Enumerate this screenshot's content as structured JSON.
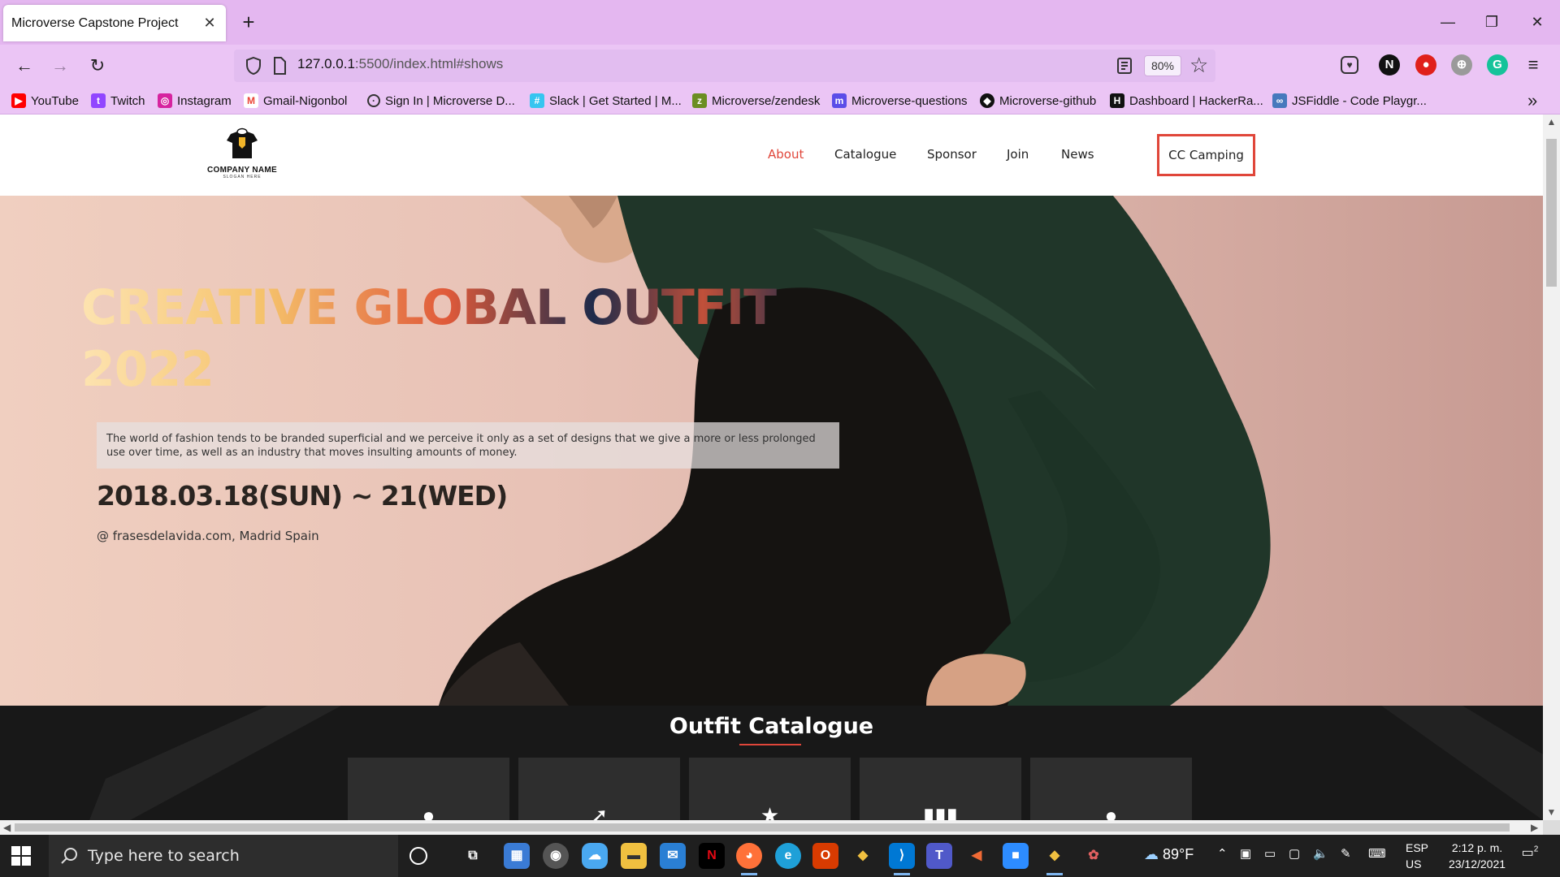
{
  "browser": {
    "tab_title": "Microverse Capstone Project",
    "url_host": "127.0.0.1",
    "url_rest": ":5500/index.html#shows",
    "zoom": "80%",
    "bookmarks": [
      {
        "label": "YouTube",
        "icon": "youtube-icon",
        "color": "#ff0000"
      },
      {
        "label": "Twitch",
        "icon": "twitch-icon",
        "color": "#9146ff"
      },
      {
        "label": "Instagram",
        "icon": "instagram-icon",
        "color": "#d6249f"
      },
      {
        "label": "Gmail-Nigonbol",
        "icon": "gmail-icon",
        "color": "#ea4335"
      },
      {
        "label": "Sign In | Microverse D...",
        "icon": "globe-icon",
        "color": "#333333"
      },
      {
        "label": "Slack | Get Started | M...",
        "icon": "slack-icon",
        "color": "#4a154b"
      },
      {
        "label": "Microverse/zendesk",
        "icon": "zendesk-icon",
        "color": "#6b8e23"
      },
      {
        "label": "Microverse-questions",
        "icon": "microverse-icon",
        "color": "#5b4de8"
      },
      {
        "label": "Microverse-github",
        "icon": "github-icon",
        "color": "#111111"
      },
      {
        "label": "Dashboard | HackerRa...",
        "icon": "hackerrank-icon",
        "color": "#111111"
      },
      {
        "label": "JSFiddle - Code Playgr...",
        "icon": "jsfiddle-icon",
        "color": "#4679bd"
      }
    ]
  },
  "site": {
    "logo_name": "COMPANY NAME",
    "logo_slogan": "SLOGAN HERE",
    "nav": [
      "About",
      "Catalogue",
      "Sponsor",
      "Join",
      "News"
    ],
    "cta": "CC Camping",
    "accent": "#e0463a"
  },
  "hero": {
    "title_line1": "CREATIVE GLOBAL OUTFIT",
    "title_line2": "2022",
    "description": "The world of fashion tends to be branded superficial and we perceive it only as a set of designs that we give a more or less prolonged use over time, as well as an industry that moves insulting amounts of money.",
    "date": "2018.03.18(SUN) ~ 21(WED)",
    "location": "@ frasesdelavida.com, Madrid Spain"
  },
  "catalogue": {
    "title": "Outfit Catalogue",
    "cards": [
      {
        "icon": "person-icon"
      },
      {
        "icon": "arrow-icon"
      },
      {
        "icon": "star-icon"
      },
      {
        "icon": "chart-icon"
      },
      {
        "icon": "info-icon"
      }
    ]
  },
  "taskbar": {
    "search_placeholder": "Type here to search",
    "weather": "89°F",
    "lang_top": "ESP",
    "lang_bottom": "US",
    "time": "2:12 p. m.",
    "date": "23/12/2021",
    "notifications": "2"
  }
}
